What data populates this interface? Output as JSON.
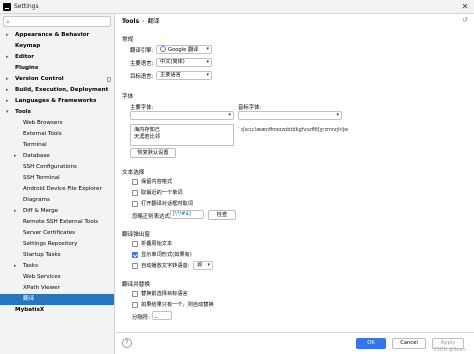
{
  "window": {
    "title": "Settings"
  },
  "sidebar": {
    "search_placeholder": "",
    "items": [
      {
        "label": "Appearance & Behavior",
        "level": 0,
        "arrow": "▸",
        "bold": true
      },
      {
        "label": "Keymap",
        "level": 0,
        "arrow": "",
        "bold": true
      },
      {
        "label": "Editor",
        "level": 0,
        "arrow": "▸",
        "bold": true
      },
      {
        "label": "Plugins",
        "level": 0,
        "arrow": "",
        "bold": true
      },
      {
        "label": "Version Control",
        "level": 0,
        "arrow": "▸",
        "bold": true
      },
      {
        "label": "Build, Execution, Deployment",
        "level": 0,
        "arrow": "▸",
        "bold": true
      },
      {
        "label": "Languages & Frameworks",
        "level": 0,
        "arrow": "▸",
        "bold": true
      },
      {
        "label": "Tools",
        "level": 0,
        "arrow": "▾",
        "bold": true
      },
      {
        "label": "Web Browsers",
        "level": 1,
        "arrow": "",
        "bold": false
      },
      {
        "label": "External Tools",
        "level": 1,
        "arrow": "",
        "bold": false
      },
      {
        "label": "Terminal",
        "level": 1,
        "arrow": "",
        "bold": false
      },
      {
        "label": "Database",
        "level": 1,
        "arrow": "▸",
        "bold": false
      },
      {
        "label": "SSH Configurations",
        "level": 1,
        "arrow": "",
        "bold": false
      },
      {
        "label": "SSH Terminal",
        "level": 1,
        "arrow": "",
        "bold": false
      },
      {
        "label": "Android Device File Explorer",
        "level": 1,
        "arrow": "",
        "bold": false
      },
      {
        "label": "Diagrams",
        "level": 1,
        "arrow": "",
        "bold": false
      },
      {
        "label": "Diff & Merge",
        "level": 1,
        "arrow": "▸",
        "bold": false
      },
      {
        "label": "Remote SSH External Tools",
        "level": 1,
        "arrow": "",
        "bold": false
      },
      {
        "label": "Server Certificates",
        "level": 1,
        "arrow": "",
        "bold": false
      },
      {
        "label": "Settings Repository",
        "level": 1,
        "arrow": "",
        "bold": false
      },
      {
        "label": "Startup Tasks",
        "level": 1,
        "arrow": "",
        "bold": false
      },
      {
        "label": "Tasks",
        "level": 1,
        "arrow": "▸",
        "bold": false
      },
      {
        "label": "Web Services",
        "level": 1,
        "arrow": "",
        "bold": false
      },
      {
        "label": "XPath Viewer",
        "level": 1,
        "arrow": "",
        "bold": false
      },
      {
        "label": "翻译",
        "level": 1,
        "arrow": "",
        "bold": false,
        "selected": true
      },
      {
        "label": "MybatisX",
        "level": 0,
        "arrow": "",
        "bold": true
      }
    ]
  },
  "breadcrumb": {
    "parent": "Tools",
    "separator": "›",
    "current": "翻译"
  },
  "general": {
    "title": "常规",
    "engine_label": "翻译引擎:",
    "engine_value": "Google 翻译",
    "primary_lang_label": "主要语言:",
    "primary_lang_value": "中文(简体)",
    "target_lang_label": "目标语言:",
    "target_lang_value": "主要语言"
  },
  "font": {
    "title": "字体",
    "primary_font_label": "主要字体:",
    "phonetic_font_label": "音标字体:",
    "preview_lines": [
      "海内存知己",
      "天涯若比邻"
    ],
    "phonetic_sample": "ˈ ɪʃscuːlæænθʊəɑzɒbtdkɡfvszθðʃʒrzmnŋhljw",
    "reset_button": "恢复默认设置"
  },
  "text_select": {
    "title": "文本选择",
    "options": [
      {
        "label": "保留内容格式",
        "checked": false
      },
      {
        "label": "取最近的一个单词",
        "checked": false
      },
      {
        "label": "打开翻译对话框时取词",
        "checked": false
      }
    ],
    "regex_label": "忽略正则表达式:",
    "regex_value": "[\\*/#$]",
    "check_button": "检查"
  },
  "popup": {
    "title": "翻译弹出窗",
    "options": [
      {
        "label": "折叠原始文本",
        "checked": false
      },
      {
        "label": "显示单词形式(如果有)",
        "checked": true
      },
      {
        "label": "自动播放文字转语音:",
        "checked": false
      }
    ],
    "tts_value": "源"
  },
  "replace": {
    "title": "翻译并替换",
    "options": [
      {
        "label": "替换前选择目标语言",
        "checked": false
      },
      {
        "label": "如果结果只有一个，则自动替换",
        "checked": false
      }
    ],
    "separator_label": "分隔符:",
    "separator_value": "_"
  },
  "footer": {
    "help_label": "?",
    "ok": "OK",
    "cancel": "Cancel",
    "apply": "Apply"
  },
  "watermark": "CSDN @Sean..."
}
